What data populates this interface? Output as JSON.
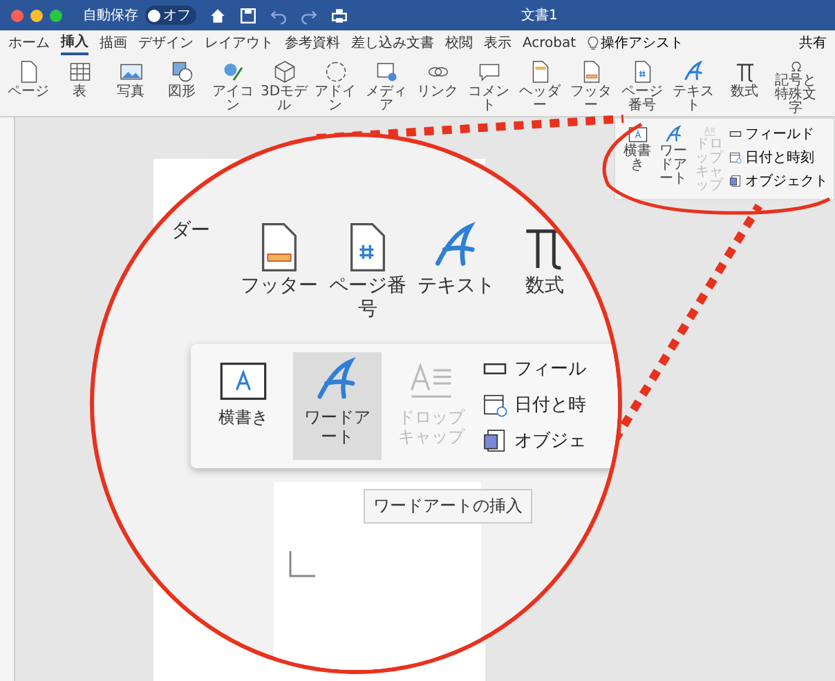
{
  "window": {
    "autosave": {
      "label": "自動保存",
      "on": false,
      "state_label": "オフ"
    },
    "title": "文書1"
  },
  "tabs": [
    {
      "label": "ホーム",
      "selected": false
    },
    {
      "label": "挿入",
      "selected": true
    },
    {
      "label": "描画",
      "selected": false
    },
    {
      "label": "デザイン",
      "selected": false
    },
    {
      "label": "レイアウト",
      "selected": false
    },
    {
      "label": "参考資料",
      "selected": false
    },
    {
      "label": "差し込み文書",
      "selected": false
    },
    {
      "label": "校閲",
      "selected": false
    },
    {
      "label": "表示",
      "selected": false
    },
    {
      "label": "Acrobat",
      "selected": false
    }
  ],
  "assist": "操作アシスト",
  "share": "共有",
  "ribbon": [
    {
      "label": "ページ",
      "kind": "page"
    },
    {
      "label": "表",
      "kind": "table"
    },
    {
      "label": "写真",
      "kind": "picture"
    },
    {
      "label": "図形",
      "kind": "shape"
    },
    {
      "label": "アイコン",
      "kind": "icons"
    },
    {
      "label": "3Dモデル",
      "kind": "cube"
    },
    {
      "label": "アドイン",
      "kind": "addin"
    },
    {
      "label": "メディア",
      "kind": "media"
    },
    {
      "label": "リンク",
      "kind": "link"
    },
    {
      "label": "コメント",
      "kind": "comment"
    },
    {
      "label": "ヘッダー",
      "kind": "header"
    },
    {
      "label": "フッター",
      "kind": "footer"
    },
    {
      "label": "ページ番号",
      "kind": "pagenum"
    },
    {
      "label": "テキスト",
      "kind": "text"
    },
    {
      "label": "数式",
      "kind": "pi"
    },
    {
      "label": "記号と特殊文字",
      "kind": "omega"
    }
  ],
  "text_menu": {
    "items": [
      {
        "label": "横書き",
        "kind": "textbox",
        "disabled": false
      },
      {
        "label": "ワードアート",
        "kind": "wordart",
        "disabled": false
      },
      {
        "label": "ドロップキャップ",
        "kind": "dropcap",
        "disabled": true
      }
    ],
    "side": [
      {
        "label": "フィールド",
        "kind": "field"
      },
      {
        "label": "日付と時刻",
        "kind": "calendar"
      },
      {
        "label": "オブジェクト",
        "kind": "object"
      }
    ]
  },
  "magnifier": {
    "ribbon": [
      {
        "label": "ダー",
        "kind": "none"
      },
      {
        "label": "フッター",
        "kind": "footer"
      },
      {
        "label": "ページ番号",
        "kind": "pagenum"
      },
      {
        "label": "テキスト",
        "kind": "text"
      },
      {
        "label": "数式",
        "kind": "pi"
      }
    ],
    "items": [
      {
        "label": "横書き",
        "kind": "textbox",
        "disabled": false,
        "selected": false
      },
      {
        "label": "ワードアート",
        "kind": "wordart",
        "disabled": false,
        "selected": true
      },
      {
        "label": "ドロップキャップ",
        "kind": "dropcap",
        "disabled": true,
        "selected": false
      }
    ],
    "side": [
      {
        "label": "フィール",
        "kind": "field"
      },
      {
        "label": "日付と時",
        "kind": "calendar"
      },
      {
        "label": "オブジェ",
        "kind": "object"
      }
    ],
    "tooltip": "ワードアートの挿入"
  }
}
